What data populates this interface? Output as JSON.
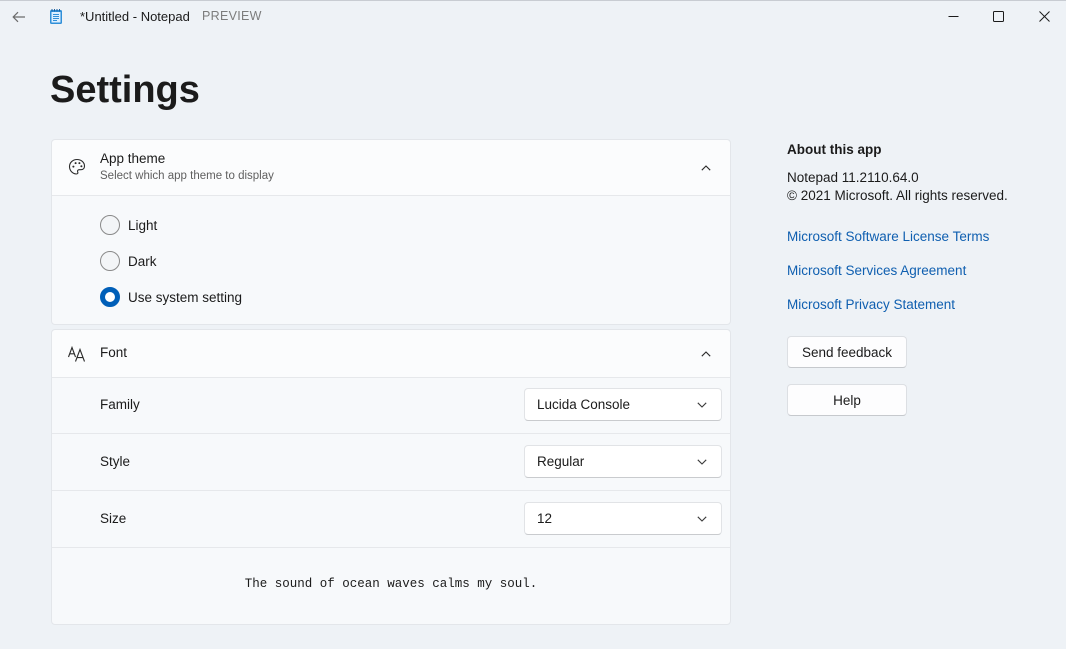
{
  "titlebar": {
    "title": "*Untitled - Notepad",
    "badge": "PREVIEW",
    "back_icon": "back-arrow-icon",
    "app_icon": "notepad-icon",
    "controls": [
      "minimize-icon",
      "maximize-icon",
      "close-icon"
    ]
  },
  "page": {
    "title": "Settings"
  },
  "theme": {
    "title": "App theme",
    "subtitle": "Select which app theme to display",
    "icon": "palette-icon",
    "expanded": true,
    "options": [
      {
        "label": "Light",
        "selected": false
      },
      {
        "label": "Dark",
        "selected": false
      },
      {
        "label": "Use system setting",
        "selected": true
      }
    ]
  },
  "font": {
    "title": "Font",
    "icon": "font-icon",
    "expanded": true,
    "rows": [
      {
        "label": "Family",
        "value": "Lucida Console"
      },
      {
        "label": "Style",
        "value": "Regular"
      },
      {
        "label": "Size",
        "value": "12"
      }
    ],
    "preview": "The sound of ocean waves calms my soul."
  },
  "about": {
    "title": "About this app",
    "version": "Notepad 11.2110.64.0",
    "copyright": "© 2021 Microsoft. All rights reserved.",
    "links": [
      "Microsoft Software License Terms",
      "Microsoft Services Agreement",
      "Microsoft Privacy Statement"
    ],
    "feedback_label": "Send feedback",
    "help_label": "Help"
  },
  "colors": {
    "accent": "#005fb8",
    "link": "#0f5fb0",
    "background": "#eef2f6",
    "card": "#f7f9fb"
  }
}
